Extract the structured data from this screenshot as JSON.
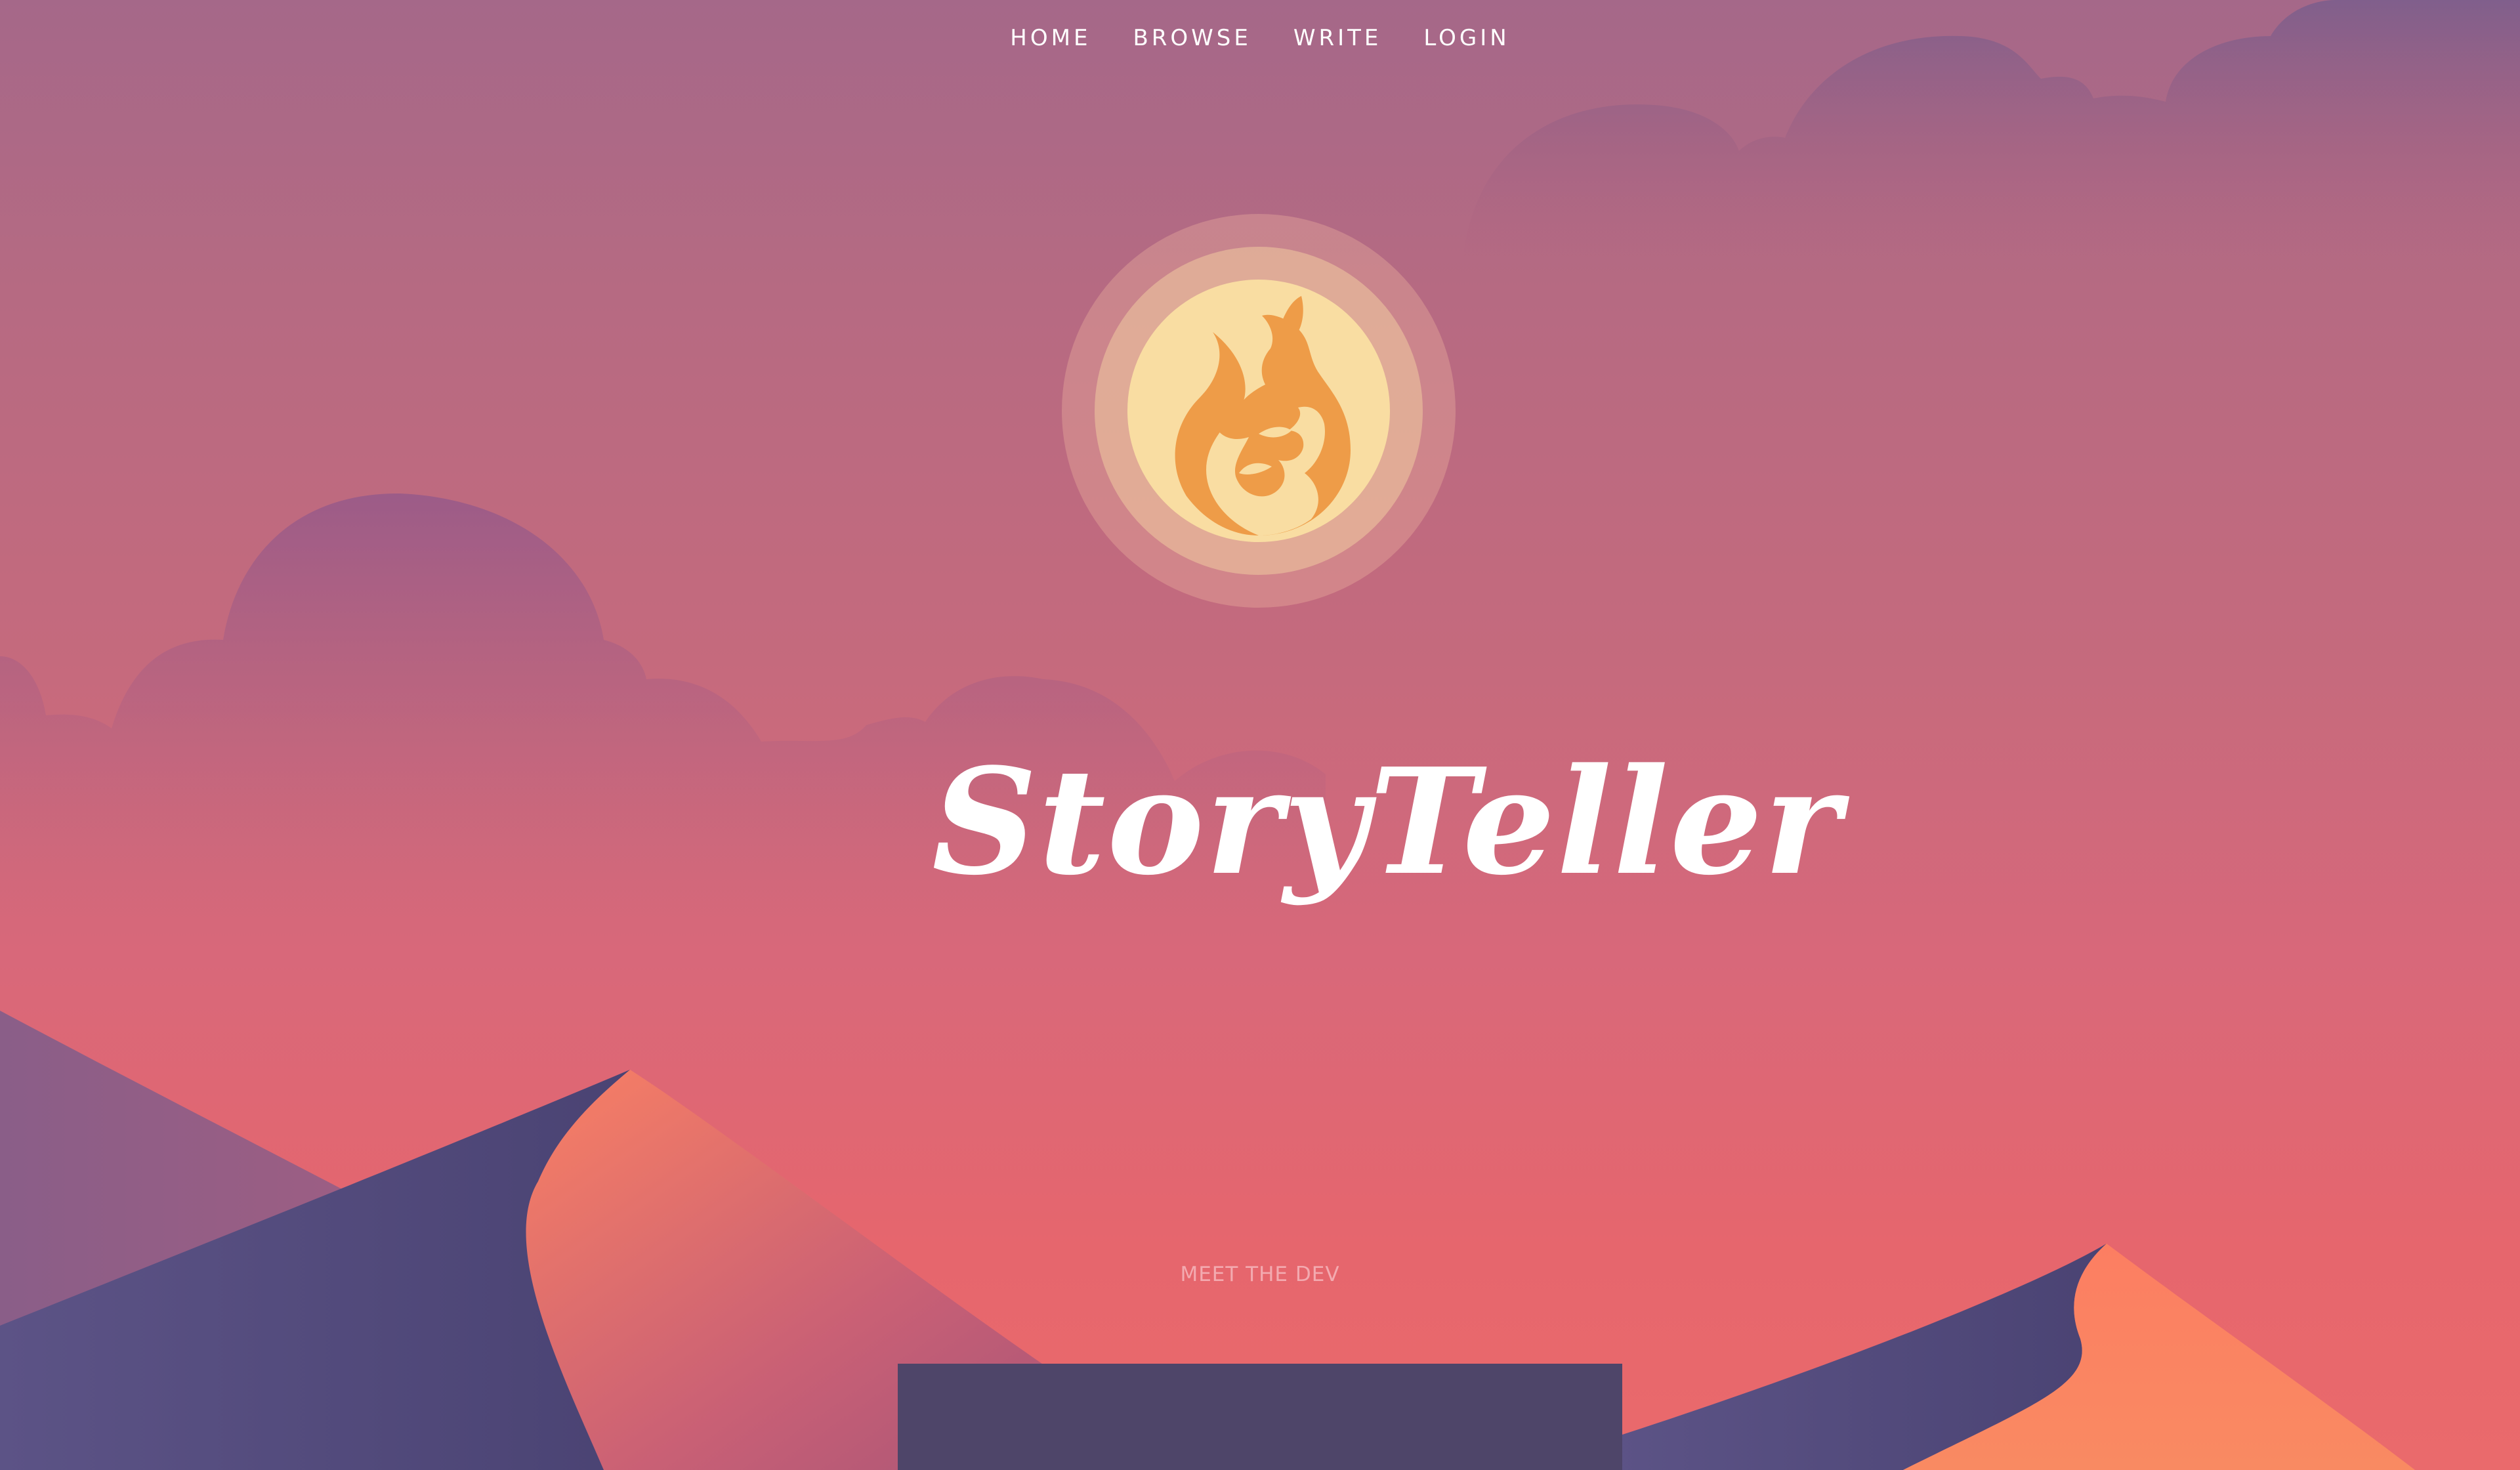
{
  "nav": {
    "items": [
      {
        "label": "HOME"
      },
      {
        "label": "BROWSE"
      },
      {
        "label": "WRITE"
      },
      {
        "label": "LOGIN"
      }
    ]
  },
  "hero": {
    "title": "StoryTeller",
    "logo_icon": "fox-icon",
    "meet_label": "MEET THE DEV"
  },
  "colors": {
    "sky_top": "#a56889",
    "sky_bottom": "#ea6a6c",
    "dune_orange": "#fb7f63",
    "dune_purple": "#4c4574",
    "sun_inner": "#f9dda2",
    "fox": "#ee9c48",
    "panel": "#4e4569"
  }
}
